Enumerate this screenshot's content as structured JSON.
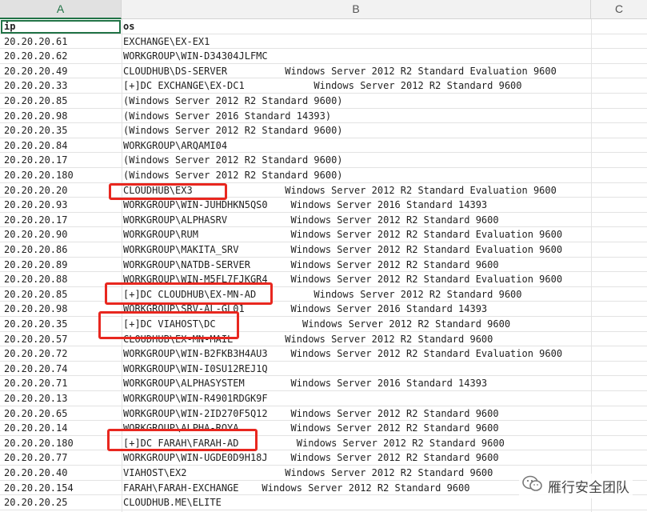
{
  "columns": [
    "A",
    "B",
    "C"
  ],
  "header_row": {
    "ip": "ip",
    "os": "os"
  },
  "rows": [
    {
      "ip": "20.20.20.61",
      "os": "EXCHANGE\\EX-EX1"
    },
    {
      "ip": "20.20.20.62",
      "os": "WORKGROUP\\WIN-D34304JLFMC"
    },
    {
      "ip": "20.20.20.49",
      "os": "CLOUDHUB\\DS-SERVER          Windows Server 2012 R2 Standard Evaluation 9600"
    },
    {
      "ip": "20.20.20.33",
      "os": "[+]DC EXCHANGE\\EX-DC1            Windows Server 2012 R2 Standard 9600"
    },
    {
      "ip": "20.20.20.85",
      "os": "(Windows Server 2012 R2 Standard 9600)"
    },
    {
      "ip": "20.20.20.98",
      "os": "(Windows Server 2016 Standard 14393)"
    },
    {
      "ip": "20.20.20.35",
      "os": "(Windows Server 2012 R2 Standard 9600)"
    },
    {
      "ip": "20.20.20.84",
      "os": "WORKGROUP\\ARQAMI04"
    },
    {
      "ip": "20.20.20.17",
      "os": "(Windows Server 2012 R2 Standard 9600)"
    },
    {
      "ip": "20.20.20.180",
      "os": "(Windows Server 2012 R2 Standard 9600)"
    },
    {
      "ip": "20.20.20.20",
      "os": "CLOUDHUB\\EX3                Windows Server 2012 R2 Standard Evaluation 9600"
    },
    {
      "ip": "20.20.20.93",
      "os": "WORKGROUP\\WIN-JUHDHKN5QS0    Windows Server 2016 Standard 14393"
    },
    {
      "ip": "20.20.20.17",
      "os": "WORKGROUP\\ALPHASRV           Windows Server 2012 R2 Standard 9600"
    },
    {
      "ip": "20.20.20.90",
      "os": "WORKGROUP\\RUM                Windows Server 2012 R2 Standard Evaluation 9600"
    },
    {
      "ip": "20.20.20.86",
      "os": "WORKGROUP\\MAKITA_SRV         Windows Server 2012 R2 Standard Evaluation 9600"
    },
    {
      "ip": "20.20.20.89",
      "os": "WORKGROUP\\NATDB-SERVER       Windows Server 2012 R2 Standard 9600"
    },
    {
      "ip": "20.20.20.88",
      "os": "WORKGROUP\\WIN-M5FL7FJKGR4    Windows Server 2012 R2 Standard Evaluation 9600"
    },
    {
      "ip": "20.20.20.85",
      "os": "[+]DC CLOUDHUB\\EX-MN-AD          Windows Server 2012 R2 Standard 9600"
    },
    {
      "ip": "20.20.20.98",
      "os": "WORKGROUP\\SRV-AL-GL01        Windows Server 2016 Standard 14393"
    },
    {
      "ip": "20.20.20.35",
      "os": "[+]DC VIAHOST\\DC               Windows Server 2012 R2 Standard 9600"
    },
    {
      "ip": "20.20.20.57",
      "os": "CLOUDHUB\\EX-MN-MAIL         Windows Server 2012 R2 Standard 9600"
    },
    {
      "ip": "20.20.20.72",
      "os": "WORKGROUP\\WIN-B2FKB3H4AU3    Windows Server 2012 R2 Standard Evaluation 9600"
    },
    {
      "ip": "20.20.20.74",
      "os": "WORKGROUP\\WIN-I0SU12REJ1Q"
    },
    {
      "ip": "20.20.20.71",
      "os": "WORKGROUP\\ALPHASYSTEM        Windows Server 2016 Standard 14393"
    },
    {
      "ip": "20.20.20.13",
      "os": "WORKGROUP\\WIN-R4901RDGK9F"
    },
    {
      "ip": "20.20.20.65",
      "os": "WORKGROUP\\WIN-2ID270F5Q12    Windows Server 2012 R2 Standard 9600"
    },
    {
      "ip": "20.20.20.14",
      "os": "WORKGROUP\\ALPHA-ROYA         Windows Server 2012 R2 Standard 9600"
    },
    {
      "ip": "20.20.20.180",
      "os": "[+]DC FARAH\\FARAH-AD          Windows Server 2012 R2 Standard 9600"
    },
    {
      "ip": "20.20.20.77",
      "os": "WORKGROUP\\WIN-UGDE0D9H18J    Windows Server 2012 R2 Standard 9600"
    },
    {
      "ip": "20.20.20.40",
      "os": "VIAHOST\\EX2                 Windows Server 2012 R2 Standard 9600"
    },
    {
      "ip": "20.20.20.154",
      "os": "FARAH\\FARAH-EXCHANGE    Windows Server 2012 R2 Standard 9600"
    },
    {
      "ip": "20.20.20.25",
      "os": "CLOUDHUB.ME\\ELITE"
    }
  ],
  "watermark": {
    "text": "雁行安全团队",
    "icon": "wechat-icon"
  },
  "colors": {
    "highlight": "#e8271f",
    "selection": "#217346"
  }
}
